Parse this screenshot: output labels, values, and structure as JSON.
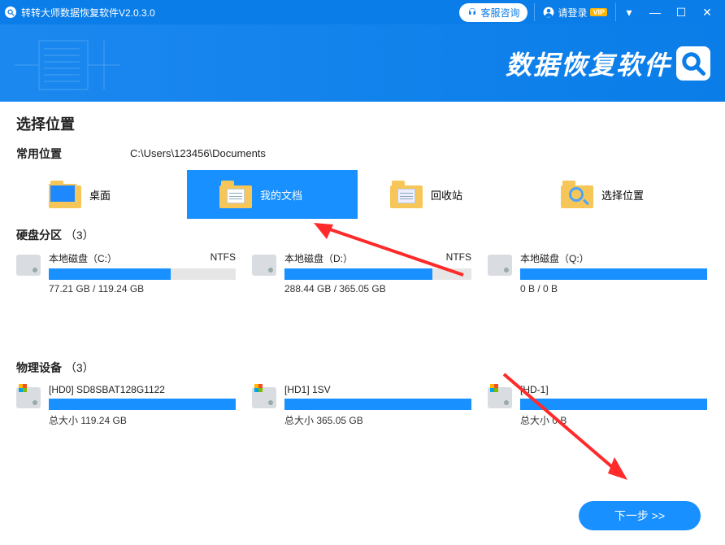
{
  "titlebar": {
    "app_title": "转转大师数据恢复软件V2.0.3.0",
    "support_label": "客服咨询",
    "login_label": "请登录",
    "vip_badge": "VIP"
  },
  "hero": {
    "brand_text": "数据恢复软件"
  },
  "section_title": "选择位置",
  "common": {
    "heading": "常用位置",
    "path": "C:\\Users\\123456\\Documents",
    "items": [
      {
        "label": "桌面"
      },
      {
        "label": "我的文档"
      },
      {
        "label": "回收站"
      },
      {
        "label": "选择位置"
      }
    ],
    "selected_index": 1
  },
  "partitions": {
    "heading": "硬盘分区",
    "count_text": "（3）",
    "fs_label": "NTFS",
    "items": [
      {
        "name": "本地磁盘（C:）",
        "fs": "NTFS",
        "size_text": "77.21 GB / 119.24 GB",
        "fill_pct": 65
      },
      {
        "name": "本地磁盘（D:）",
        "fs": "NTFS",
        "size_text": "288.44 GB / 365.05 GB",
        "fill_pct": 79
      },
      {
        "name": "本地磁盘（Q:）",
        "fs": "",
        "size_text": "0 B / 0 B",
        "fill_pct": 100
      }
    ]
  },
  "devices": {
    "heading": "物理设备",
    "count_text": "（3）",
    "size_prefix": "总大小",
    "items": [
      {
        "name": "[HD0] SD8SBAT128G1122",
        "size_text": "总大小 119.24 GB"
      },
      {
        "name": "[HD1] 1SV",
        "size_text": "总大小 365.05 GB"
      },
      {
        "name": "[HD-1]",
        "size_text": "总大小 0 B"
      }
    ]
  },
  "next_button": "下一步 >>"
}
